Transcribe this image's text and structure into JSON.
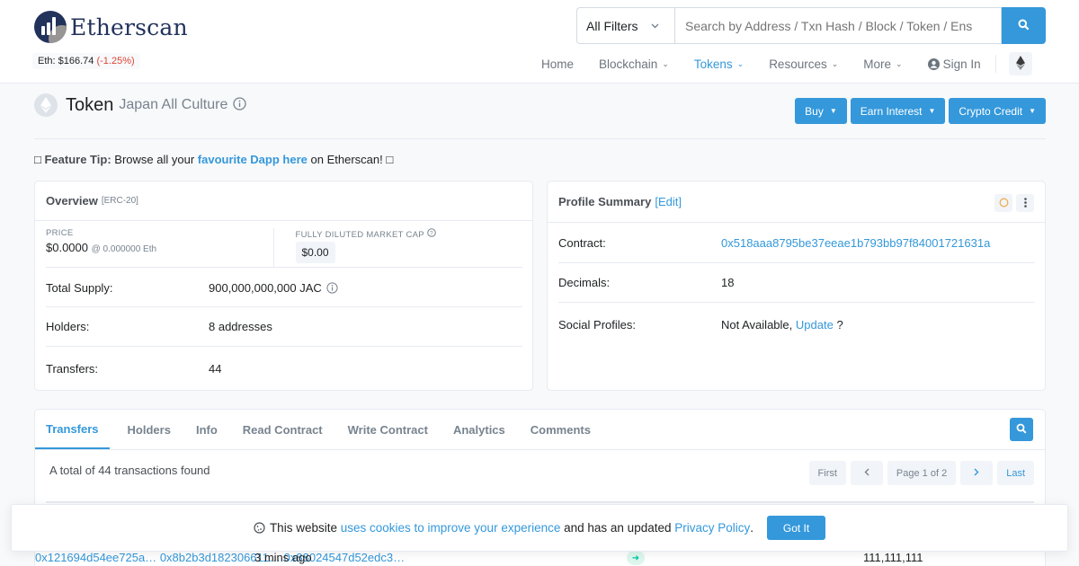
{
  "header": {
    "brand": "Etherscan",
    "eth_price_label": "Eth: $166.74",
    "eth_price_change": "(-1.25%)",
    "search": {
      "filter": "All Filters",
      "placeholder": "Search by Address / Txn Hash / Block / Token / Ens"
    },
    "nav": {
      "home": "Home",
      "blockchain": "Blockchain",
      "tokens": "Tokens",
      "resources": "Resources",
      "more": "More",
      "sign_in": "Sign In"
    }
  },
  "title": {
    "main": "Token",
    "sub": "Japan All Culture"
  },
  "buttons": {
    "buy": "Buy",
    "earn": "Earn Interest",
    "credit": "Crypto Credit"
  },
  "tip": {
    "prefix": "Feature Tip:",
    "text1": "Browse all your",
    "link": "favourite Dapp here",
    "text2": "on Etherscan!"
  },
  "overview": {
    "title": "Overview",
    "standard": "[ERC-20]",
    "price_label": "PRICE",
    "price_value": "$0.0000",
    "price_eth": "@ 0.000000 Eth",
    "mcap_label": "FULLY DILUTED MARKET CAP",
    "mcap_value": "$0.00",
    "total_supply_label": "Total Supply:",
    "total_supply_value": "900,000,000,000 JAC",
    "holders_label": "Holders:",
    "holders_value": "8 addresses",
    "transfers_label": "Transfers:",
    "transfers_value": "44"
  },
  "profile": {
    "title": "Profile Summary",
    "edit": "[Edit]",
    "contract_label": "Contract:",
    "contract_value": "0x518aaa8795be37eeae1b793bb97f84001721631a",
    "decimals_label": "Decimals:",
    "decimals_value": "18",
    "social_label": "Social Profiles:",
    "social_value": "Not Available,",
    "social_update": "Update",
    "social_q": "?"
  },
  "tabs": [
    "Transfers",
    "Holders",
    "Info",
    "Read Contract",
    "Write Contract",
    "Analytics",
    "Comments"
  ],
  "transfers": {
    "total": "A total of 44 transactions found",
    "pager": {
      "first": "First",
      "page": "Page 1 of 2",
      "last": "Last"
    },
    "row": {
      "hash": "0x121694d54ee725a…",
      "age": "3 mins ago",
      "from": "0x8b2b3d182306611…",
      "to": "0x88024547d52edc3…",
      "qty": "111,111,111"
    }
  },
  "cookie": {
    "text1": "This website",
    "link1": "uses cookies to improve your experience",
    "text2": "and has an updated",
    "link2": "Privacy Policy",
    "text3": ".",
    "button": "Got It"
  },
  "colors": {
    "primary": "#3498db",
    "brand_navy": "#21325b",
    "negative": "#de4437",
    "success": "#00c9a7"
  }
}
